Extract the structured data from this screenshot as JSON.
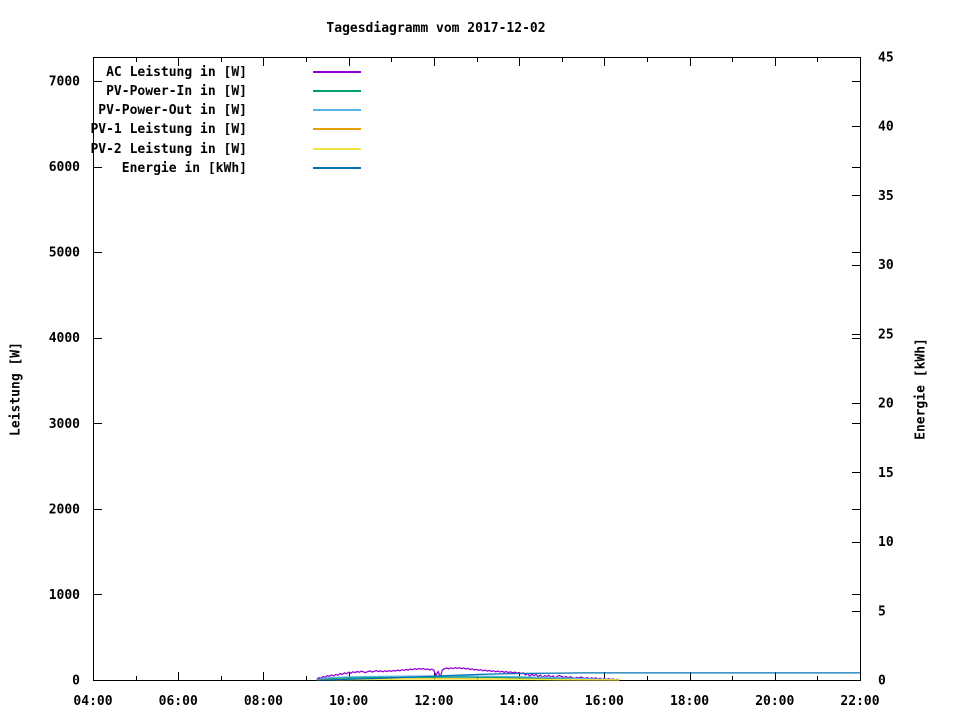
{
  "chart_data": {
    "type": "line",
    "title": "Tagesdiagramm vom 2017-12-02",
    "background": "#ffffff",
    "grid": false,
    "legend_position": "top-left-inside",
    "x_axis": {
      "range_hours": [
        4,
        22
      ],
      "major_ticks": [
        {
          "hour": 4,
          "label": "04:00"
        },
        {
          "hour": 6,
          "label": "06:00"
        },
        {
          "hour": 8,
          "label": "08:00"
        },
        {
          "hour": 10,
          "label": "10:00"
        },
        {
          "hour": 12,
          "label": "12:00"
        },
        {
          "hour": 14,
          "label": "14:00"
        },
        {
          "hour": 16,
          "label": "16:00"
        },
        {
          "hour": 18,
          "label": "18:00"
        },
        {
          "hour": 20,
          "label": "20:00"
        },
        {
          "hour": 22,
          "label": "22:00"
        }
      ],
      "minor_hours": [
        5,
        7,
        9,
        11,
        13,
        15,
        17,
        19,
        21
      ]
    },
    "y_axis": {
      "label": "Leistung [W]",
      "range": [
        0,
        7280
      ],
      "major_ticks": [
        {
          "value": 0,
          "label": "0"
        },
        {
          "value": 1000,
          "label": "1000"
        },
        {
          "value": 2000,
          "label": "2000"
        },
        {
          "value": 3000,
          "label": "3000"
        },
        {
          "value": 4000,
          "label": "4000"
        },
        {
          "value": 5000,
          "label": "5000"
        },
        {
          "value": 6000,
          "label": "6000"
        },
        {
          "value": 7000,
          "label": "7000"
        }
      ]
    },
    "y2_axis": {
      "label": "Energie [kWh]",
      "range": [
        0,
        45
      ],
      "major_ticks": [
        {
          "value": 0,
          "label": "0"
        },
        {
          "value": 5,
          "label": "5"
        },
        {
          "value": 10,
          "label": "10"
        },
        {
          "value": 15,
          "label": "15"
        },
        {
          "value": 20,
          "label": "20"
        },
        {
          "value": 25,
          "label": "25"
        },
        {
          "value": 30,
          "label": "30"
        },
        {
          "value": 35,
          "label": "35"
        },
        {
          "value": 40,
          "label": "40"
        },
        {
          "value": 45,
          "label": "45"
        }
      ]
    },
    "series": [
      {
        "name": "AC Leistung in [W]",
        "color": "#9400d3",
        "yaxis": "y1",
        "points": [
          [
            9.25,
            8
          ],
          [
            9.3,
            28
          ],
          [
            9.35,
            20
          ],
          [
            9.4,
            40
          ],
          [
            9.45,
            32
          ],
          [
            9.5,
            52
          ],
          [
            9.55,
            42
          ],
          [
            9.6,
            60
          ],
          [
            9.65,
            48
          ],
          [
            9.7,
            66
          ],
          [
            9.75,
            56
          ],
          [
            9.8,
            76
          ],
          [
            9.85,
            64
          ],
          [
            9.9,
            84
          ],
          [
            9.95,
            72
          ],
          [
            10.0,
            92
          ],
          [
            10.05,
            80
          ],
          [
            10.1,
            96
          ],
          [
            10.15,
            86
          ],
          [
            10.2,
            100
          ],
          [
            10.25,
            90
          ],
          [
            10.3,
            104
          ],
          [
            10.35,
            94
          ],
          [
            10.4,
            86
          ],
          [
            10.45,
            98
          ],
          [
            10.5,
            106
          ],
          [
            10.55,
            92
          ],
          [
            10.6,
            102
          ],
          [
            10.65,
            110
          ],
          [
            10.7,
            98
          ],
          [
            10.75,
            106
          ],
          [
            10.8,
            96
          ],
          [
            10.85,
            108
          ],
          [
            10.9,
            98
          ],
          [
            10.95,
            110
          ],
          [
            11.0,
            100
          ],
          [
            11.05,
            112
          ],
          [
            11.1,
            104
          ],
          [
            11.15,
            116
          ],
          [
            11.2,
            108
          ],
          [
            11.25,
            120
          ],
          [
            11.3,
            112
          ],
          [
            11.35,
            124
          ],
          [
            11.4,
            116
          ],
          [
            11.45,
            128
          ],
          [
            11.5,
            120
          ],
          [
            11.55,
            132
          ],
          [
            11.6,
            124
          ],
          [
            11.65,
            134
          ],
          [
            11.7,
            126
          ],
          [
            11.75,
            134
          ],
          [
            11.8,
            122
          ],
          [
            11.85,
            130
          ],
          [
            11.9,
            118
          ],
          [
            11.95,
            126
          ],
          [
            12.0,
            114
          ],
          [
            12.05,
            52
          ],
          [
            12.1,
            102
          ],
          [
            12.15,
            34
          ],
          [
            12.2,
            118
          ],
          [
            12.25,
            132
          ],
          [
            12.3,
            140
          ],
          [
            12.35,
            130
          ],
          [
            12.4,
            142
          ],
          [
            12.45,
            132
          ],
          [
            12.5,
            145
          ],
          [
            12.55,
            136
          ],
          [
            12.6,
            144
          ],
          [
            12.65,
            132
          ],
          [
            12.7,
            140
          ],
          [
            12.75,
            128
          ],
          [
            12.8,
            136
          ],
          [
            12.85,
            122
          ],
          [
            12.9,
            130
          ],
          [
            12.95,
            118
          ],
          [
            13.0,
            124
          ],
          [
            13.05,
            112
          ],
          [
            13.1,
            120
          ],
          [
            13.15,
            108
          ],
          [
            13.2,
            116
          ],
          [
            13.25,
            104
          ],
          [
            13.3,
            112
          ],
          [
            13.35,
            100
          ],
          [
            13.4,
            108
          ],
          [
            13.45,
            96
          ],
          [
            13.5,
            106
          ],
          [
            13.55,
            94
          ],
          [
            13.6,
            102
          ],
          [
            13.65,
            90
          ],
          [
            13.7,
            98
          ],
          [
            13.75,
            86
          ],
          [
            13.8,
            96
          ],
          [
            13.85,
            84
          ],
          [
            13.9,
            92
          ],
          [
            13.95,
            80
          ],
          [
            14.0,
            88
          ],
          [
            14.05,
            74
          ],
          [
            14.1,
            84
          ],
          [
            14.15,
            58
          ],
          [
            14.2,
            76
          ],
          [
            14.25,
            44
          ],
          [
            14.3,
            68
          ],
          [
            14.35,
            52
          ],
          [
            14.4,
            64
          ],
          [
            14.45,
            38
          ],
          [
            14.5,
            58
          ],
          [
            14.55,
            28
          ],
          [
            14.6,
            52
          ],
          [
            14.65,
            42
          ],
          [
            14.7,
            56
          ],
          [
            14.75,
            32
          ],
          [
            14.8,
            48
          ],
          [
            14.85,
            24
          ],
          [
            14.9,
            44
          ],
          [
            14.95,
            52
          ],
          [
            15.0,
            38
          ],
          [
            15.05,
            28
          ],
          [
            15.1,
            42
          ],
          [
            15.15,
            24
          ],
          [
            15.2,
            38
          ],
          [
            15.25,
            28
          ],
          [
            15.3,
            18
          ],
          [
            15.35,
            32
          ],
          [
            15.4,
            22
          ],
          [
            15.45,
            36
          ],
          [
            15.5,
            26
          ],
          [
            15.55,
            16
          ],
          [
            15.6,
            28
          ],
          [
            15.65,
            14
          ],
          [
            15.7,
            24
          ],
          [
            15.75,
            16
          ],
          [
            15.8,
            26
          ],
          [
            15.85,
            12
          ],
          [
            15.9,
            20
          ],
          [
            15.95,
            8
          ],
          [
            16.0,
            18
          ],
          [
            16.05,
            6
          ],
          [
            16.1,
            16
          ],
          [
            16.15,
            6
          ],
          [
            16.2,
            12
          ],
          [
            16.25,
            4
          ],
          [
            16.3,
            8
          ],
          [
            16.35,
            2
          ]
        ]
      },
      {
        "name": "PV-Power-In in [W]",
        "color": "#009e73",
        "yaxis": "y1",
        "points": [
          [
            9.25,
            4
          ],
          [
            9.5,
            16
          ],
          [
            9.75,
            22
          ],
          [
            10.0,
            25
          ],
          [
            10.5,
            28
          ],
          [
            11.0,
            30
          ],
          [
            11.5,
            32
          ],
          [
            12.0,
            33
          ],
          [
            12.5,
            35
          ],
          [
            13.0,
            32
          ],
          [
            13.5,
            30
          ],
          [
            14.0,
            26
          ],
          [
            14.5,
            22
          ],
          [
            15.0,
            18
          ],
          [
            15.5,
            12
          ],
          [
            16.0,
            6
          ],
          [
            16.35,
            2
          ]
        ]
      },
      {
        "name": "PV-Power-Out in [W]",
        "color": "#56b4e9",
        "yaxis": "y1",
        "points": [
          [
            9.25,
            6
          ],
          [
            9.5,
            24
          ],
          [
            9.75,
            32
          ],
          [
            10.0,
            36
          ],
          [
            10.5,
            41
          ],
          [
            11.0,
            44
          ],
          [
            11.5,
            46
          ],
          [
            12.0,
            47
          ],
          [
            12.5,
            48
          ],
          [
            13.0,
            45
          ],
          [
            13.5,
            42
          ],
          [
            14.0,
            37
          ],
          [
            14.5,
            30
          ],
          [
            15.0,
            24
          ],
          [
            15.5,
            16
          ],
          [
            16.0,
            8
          ],
          [
            16.35,
            3
          ]
        ]
      },
      {
        "name": "PV-1 Leistung in [W]",
        "color": "#e69f00",
        "yaxis": "y1",
        "points": [
          [
            9.25,
            2
          ],
          [
            10.0,
            8
          ],
          [
            11.0,
            12
          ],
          [
            12.0,
            14
          ],
          [
            12.5,
            15
          ],
          [
            13.0,
            13
          ],
          [
            14.0,
            10
          ],
          [
            15.0,
            6
          ],
          [
            16.0,
            2
          ],
          [
            16.35,
            1
          ]
        ]
      },
      {
        "name": "PV-2 Leistung in [W]",
        "color": "#f0e442",
        "yaxis": "y1",
        "points": [
          [
            9.25,
            1
          ],
          [
            10.0,
            5
          ],
          [
            11.0,
            8
          ],
          [
            12.0,
            10
          ],
          [
            12.5,
            10
          ],
          [
            13.0,
            9
          ],
          [
            14.0,
            7
          ],
          [
            15.0,
            4
          ],
          [
            16.0,
            1
          ],
          [
            16.35,
            0
          ]
        ]
      },
      {
        "name": "Energie in [kWh]",
        "color": "#0072b2",
        "yaxis": "y2",
        "points": [
          [
            9.25,
            0
          ],
          [
            9.5,
            0.01
          ],
          [
            10.0,
            0.05
          ],
          [
            10.5,
            0.1
          ],
          [
            11.0,
            0.15
          ],
          [
            11.5,
            0.21
          ],
          [
            12.0,
            0.27
          ],
          [
            12.5,
            0.34
          ],
          [
            13.0,
            0.4
          ],
          [
            13.5,
            0.44
          ],
          [
            14.0,
            0.47
          ],
          [
            14.5,
            0.49
          ],
          [
            15.0,
            0.5
          ],
          [
            15.5,
            0.51
          ],
          [
            16.0,
            0.51
          ],
          [
            16.35,
            0.51
          ],
          [
            22.0,
            0.51
          ]
        ]
      }
    ]
  }
}
